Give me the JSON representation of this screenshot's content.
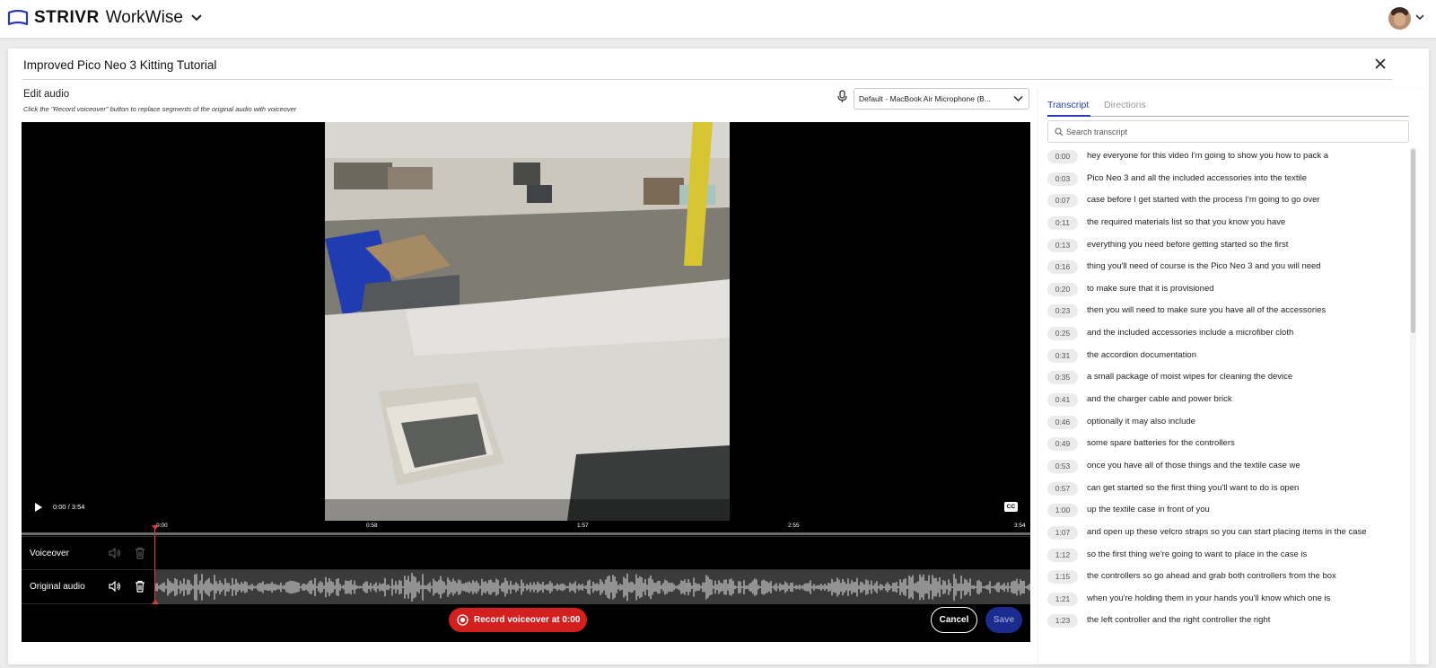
{
  "header": {
    "brand_name": "STRIVR",
    "product_name": "WorkWise"
  },
  "editor": {
    "title": "Improved Pico Neo 3 Kitting Tutorial",
    "section_label": "Edit audio",
    "section_hint": "Click the \"Record voiceover\" button to replace segments of the original audio with voiceover",
    "microphone": "Default - MacBook Air Microphone (B...",
    "player": {
      "time": "0:00 / 3:54",
      "cc_label": "CC"
    },
    "timeline": {
      "ticks": [
        "0:00",
        "0:58",
        "1:57",
        "2:55",
        "3:54"
      ],
      "tracks": [
        {
          "label": "Voiceover",
          "enabled": false
        },
        {
          "label": "Original audio",
          "enabled": true
        }
      ]
    },
    "record_label": "Record voiceover at 0:00",
    "cancel_label": "Cancel",
    "save_label": "Save"
  },
  "transcript_panel": {
    "tabs": [
      "Transcript",
      "Directions"
    ],
    "active_tab": "Transcript",
    "search_placeholder": "Search transcript",
    "rows": [
      {
        "time": "0:00",
        "text": "hey everyone for this video I'm going to show you how to pack a"
      },
      {
        "time": "0:03",
        "text": "Pico Neo 3 and all the included accessories into the textile"
      },
      {
        "time": "0:07",
        "text": "case before I get started with the process I'm going to go over"
      },
      {
        "time": "0:11",
        "text": "the required materials list so that you know you have"
      },
      {
        "time": "0:13",
        "text": "everything you need before getting started so the first"
      },
      {
        "time": "0:16",
        "text": "thing you'll need of course is the Pico Neo 3 and you will need"
      },
      {
        "time": "0:20",
        "text": "to make sure that it is provisioned"
      },
      {
        "time": "0:23",
        "text": "then you will need to make sure you have all of the accessories"
      },
      {
        "time": "0:25",
        "text": "and the included accessories include a microfiber cloth"
      },
      {
        "time": "0:31",
        "text": "the accordion documentation"
      },
      {
        "time": "0:35",
        "text": "a small package of moist wipes for cleaning the device"
      },
      {
        "time": "0:41",
        "text": "and the charger cable and power brick"
      },
      {
        "time": "0:46",
        "text": "optionally it may also include"
      },
      {
        "time": "0:49",
        "text": "some spare batteries for the controllers"
      },
      {
        "time": "0:53",
        "text": "once you have all of those things and the textile case we"
      },
      {
        "time": "0:57",
        "text": "can get started so the first thing you'll want to do is open"
      },
      {
        "time": "1:00",
        "text": "up the textile case in front of you"
      },
      {
        "time": "1:07",
        "text": "and open up these velcro straps so you can start placing items in the case"
      },
      {
        "time": "1:12",
        "text": "so the first thing we're going to want to place in the case is"
      },
      {
        "time": "1:15",
        "text": "the controllers so go ahead and grab both controllers from the box"
      },
      {
        "time": "1:21",
        "text": "when you're holding them in your hands you'll know which one is"
      },
      {
        "time": "1:23",
        "text": "the left controller and the right controller the right"
      }
    ]
  },
  "colors": {
    "accent": "#2a3bb4",
    "record": "#d41f1f",
    "save": "#1c2b8f",
    "playhead": "#e23a3a"
  },
  "icons": [
    "strivr-logo-icon",
    "chevron-down-icon",
    "close-icon",
    "microphone-icon",
    "play-icon",
    "volume-icon",
    "trash-icon",
    "record-icon",
    "search-icon"
  ]
}
